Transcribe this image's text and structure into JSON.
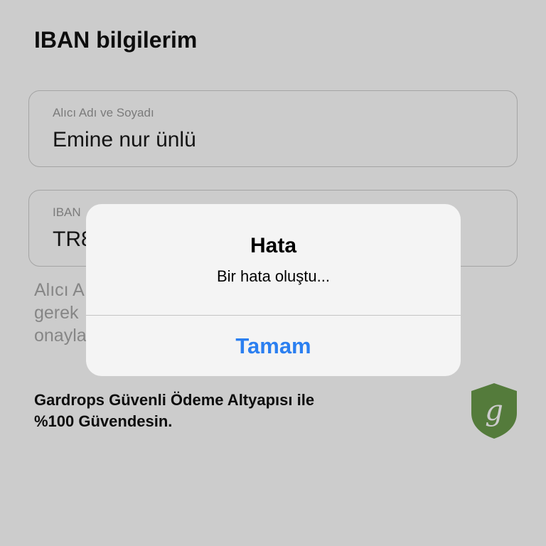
{
  "page": {
    "title": "IBAN bilgilerim",
    "fields": [
      {
        "label": "Alıcı Adı ve Soyadı",
        "value": "Emine nur ünlü"
      },
      {
        "label": "IBAN",
        "value": "TR8"
      }
    ],
    "hint_lines": [
      "Alıcı A",
      "gerek",
      "onayla"
    ],
    "secure_text_line1": "Gardrops Güvenli Ödeme Altyapısı ile",
    "secure_text_line2": "%100 Güvendesin.",
    "shield_letter": "g",
    "shield_color": "#6a9a4a"
  },
  "alert": {
    "title": "Hata",
    "message": "Bir hata oluştu...",
    "button_label": "Tamam",
    "button_color": "#2b7ff0"
  },
  "overlay": {
    "dim_color": "rgba(0,0,0,0.2)"
  }
}
